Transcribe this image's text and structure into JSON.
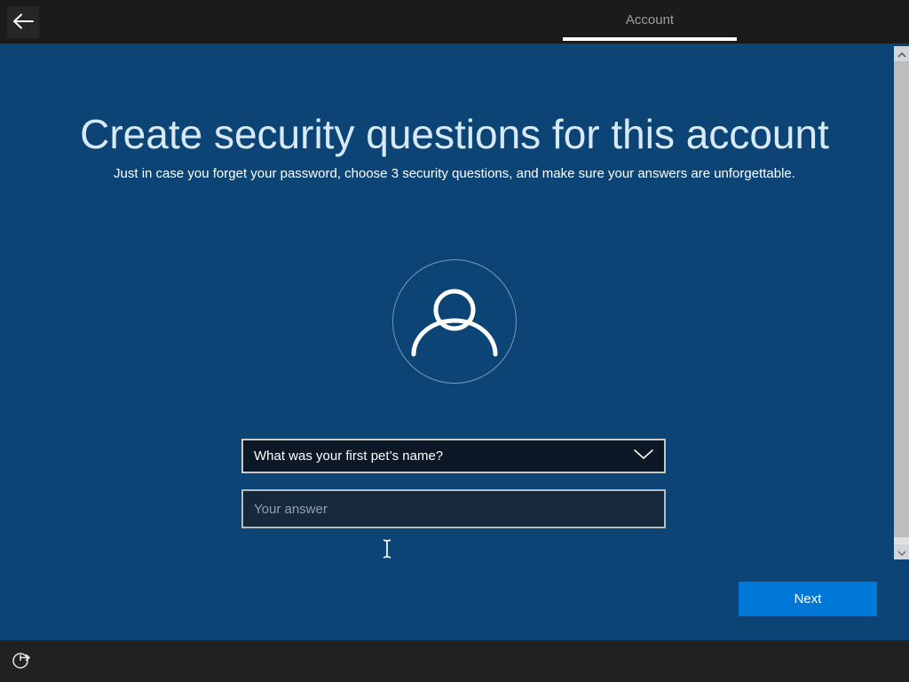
{
  "header": {
    "tab_label": "Account"
  },
  "content": {
    "title": "Create security questions for this account",
    "subtitle": "Just in case you forget your password, choose 3 security questions, and make sure your answers are unforgettable.",
    "question_select": {
      "selected": "What was your first pet’s name?"
    },
    "answer_field": {
      "placeholder": "Your answer",
      "value": ""
    },
    "next_label": "Next"
  },
  "colors": {
    "background": "#0b4475",
    "top_bar": "#1b1b1b",
    "bottom_bar": "#212121",
    "accent_button": "#0078d7",
    "title_text": "#d8eaf7",
    "field_border": "#c9c9c9",
    "dropdown_bg": "#0d1826",
    "input_bg": "#16283c",
    "tab_underline": "#ffffff"
  }
}
